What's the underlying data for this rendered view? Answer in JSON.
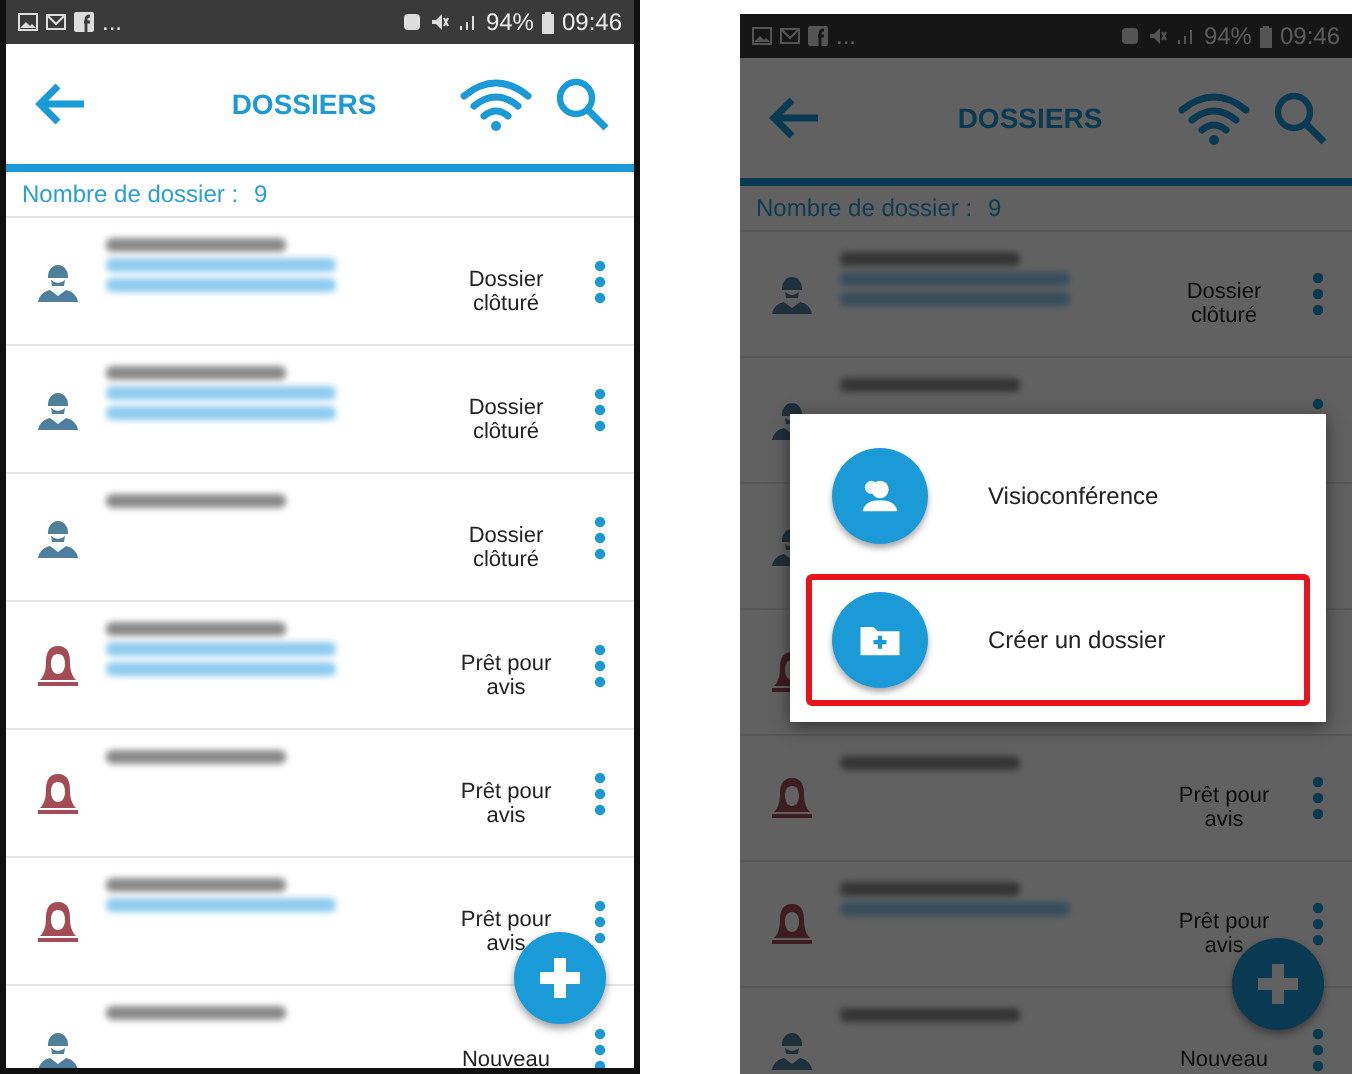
{
  "screens": [
    {
      "status_bar": {
        "overflow": "...",
        "battery": "94%",
        "time": "09:46"
      },
      "toolbar": {
        "title": "DOSSIERS"
      },
      "count": {
        "label": "Nombre de dossier :",
        "value": "9"
      },
      "rows": [
        {
          "kind": "male",
          "redactions": [
            {
              "kind": "name"
            },
            {
              "kind": "detail"
            },
            {
              "kind": "detail"
            }
          ],
          "status": "Dossier clôturé"
        },
        {
          "kind": "male",
          "redactions": [
            {
              "kind": "name"
            },
            {
              "kind": "detail"
            },
            {
              "kind": "detail"
            }
          ],
          "status": "Dossier clôturé"
        },
        {
          "kind": "male",
          "redactions": [
            {
              "kind": "name"
            }
          ],
          "status": "Dossier clôturé"
        },
        {
          "kind": "female",
          "redactions": [
            {
              "kind": "name"
            },
            {
              "kind": "detail"
            },
            {
              "kind": "detail"
            }
          ],
          "status": "Prêt pour avis"
        },
        {
          "kind": "female",
          "redactions": [
            {
              "kind": "name"
            }
          ],
          "status": "Prêt pour avis"
        },
        {
          "kind": "female",
          "redactions": [
            {
              "kind": "name"
            },
            {
              "kind": "detail"
            }
          ],
          "status": "Prêt pour avis"
        },
        {
          "kind": "male",
          "redactions": [
            {
              "kind": "name"
            }
          ],
          "status": "Nouveau"
        }
      ]
    },
    {
      "status_bar": {
        "overflow": "...",
        "battery": "94%",
        "time": "09:46"
      },
      "toolbar": {
        "title": "DOSSIERS"
      },
      "count": {
        "label": "Nombre de dossier :",
        "value": "9"
      },
      "rows": [
        {
          "kind": "male",
          "redactions": [
            {
              "kind": "name"
            },
            {
              "kind": "detail"
            },
            {
              "kind": "detail"
            }
          ],
          "status": "Dossier clôturé"
        },
        {
          "kind": "male",
          "redactions": [
            {
              "kind": "name"
            }
          ]
        },
        {
          "kind": "male"
        },
        {
          "kind": "female"
        },
        {
          "kind": "female",
          "redactions": [
            {
              "kind": "name"
            }
          ],
          "status": "Prêt pour avis"
        },
        {
          "kind": "female",
          "redactions": [
            {
              "kind": "name"
            },
            {
              "kind": "detail"
            }
          ],
          "status": "Prêt pour avis"
        },
        {
          "kind": "male",
          "redactions": [
            {
              "kind": "name"
            }
          ],
          "status": "Nouveau"
        }
      ],
      "dialog": {
        "items": [
          {
            "kind": "video",
            "label": "Visioconférence",
            "highlighted": false
          },
          {
            "kind": "folder",
            "label": "Créer un dossier",
            "highlighted": true
          }
        ]
      }
    }
  ]
}
